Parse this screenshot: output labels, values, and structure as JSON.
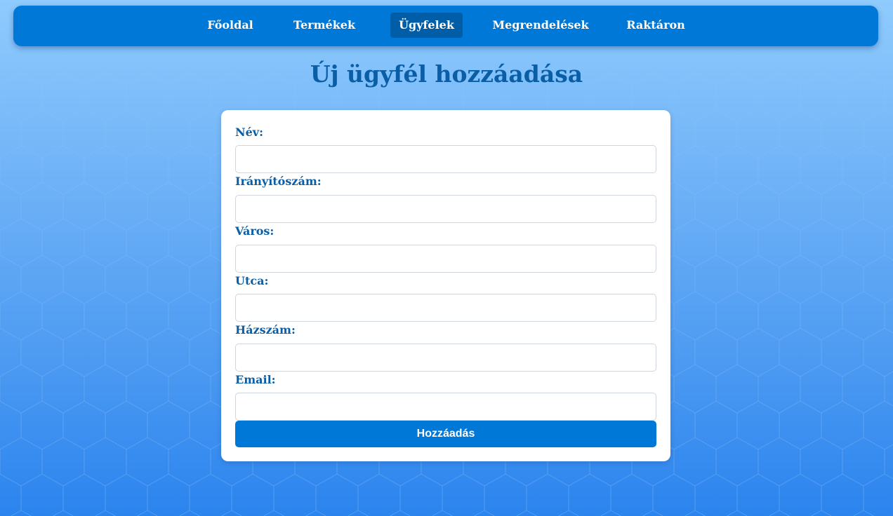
{
  "nav": {
    "items": [
      {
        "label": "Főoldal"
      },
      {
        "label": "Termékek"
      },
      {
        "label": "Ügyfelek",
        "active": true
      },
      {
        "label": "Megrendelések"
      },
      {
        "label": "Raktáron"
      }
    ]
  },
  "page": {
    "title": "Új ügyfél hozzáadása"
  },
  "form": {
    "fields": [
      {
        "label": "Név:",
        "value": ""
      },
      {
        "label": "Irányítószám:",
        "value": ""
      },
      {
        "label": "Város:",
        "value": ""
      },
      {
        "label": "Utca:",
        "value": ""
      },
      {
        "label": "Házszám:",
        "value": ""
      },
      {
        "label": "Email:",
        "value": ""
      }
    ],
    "submit_label": "Hozzáadás"
  },
  "colors": {
    "nav_bg": "#0078d7",
    "nav_active": "#005ea8",
    "title": "#0a5ea6",
    "button": "#0078d7"
  }
}
